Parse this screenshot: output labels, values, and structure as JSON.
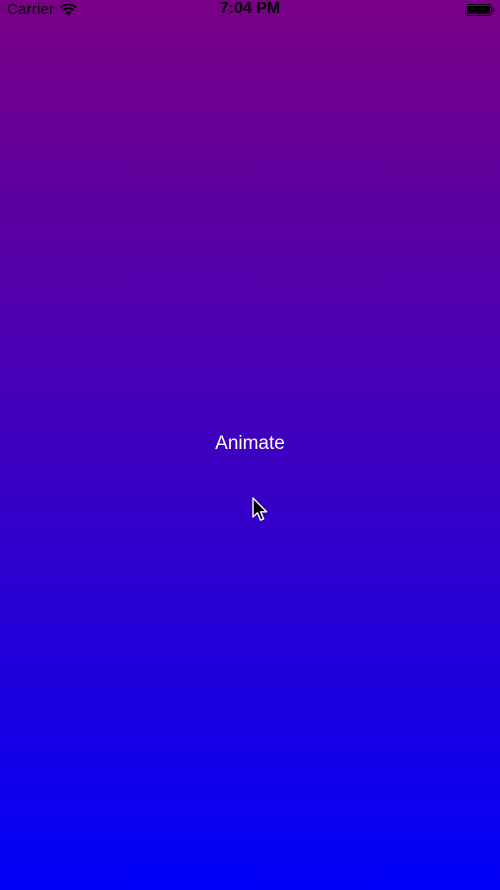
{
  "status_bar": {
    "carrier": "Carrier",
    "time": "7:04 PM",
    "icons": [
      "wifi-icon",
      "battery-icon"
    ]
  },
  "main": {
    "animate_button_label": "Animate"
  },
  "colors": {
    "gradient_top": "#7a0085",
    "gradient_bottom": "#0000f8",
    "button_text": "#ffffff"
  },
  "pointer": {
    "icon": "mouse-cursor-icon"
  }
}
